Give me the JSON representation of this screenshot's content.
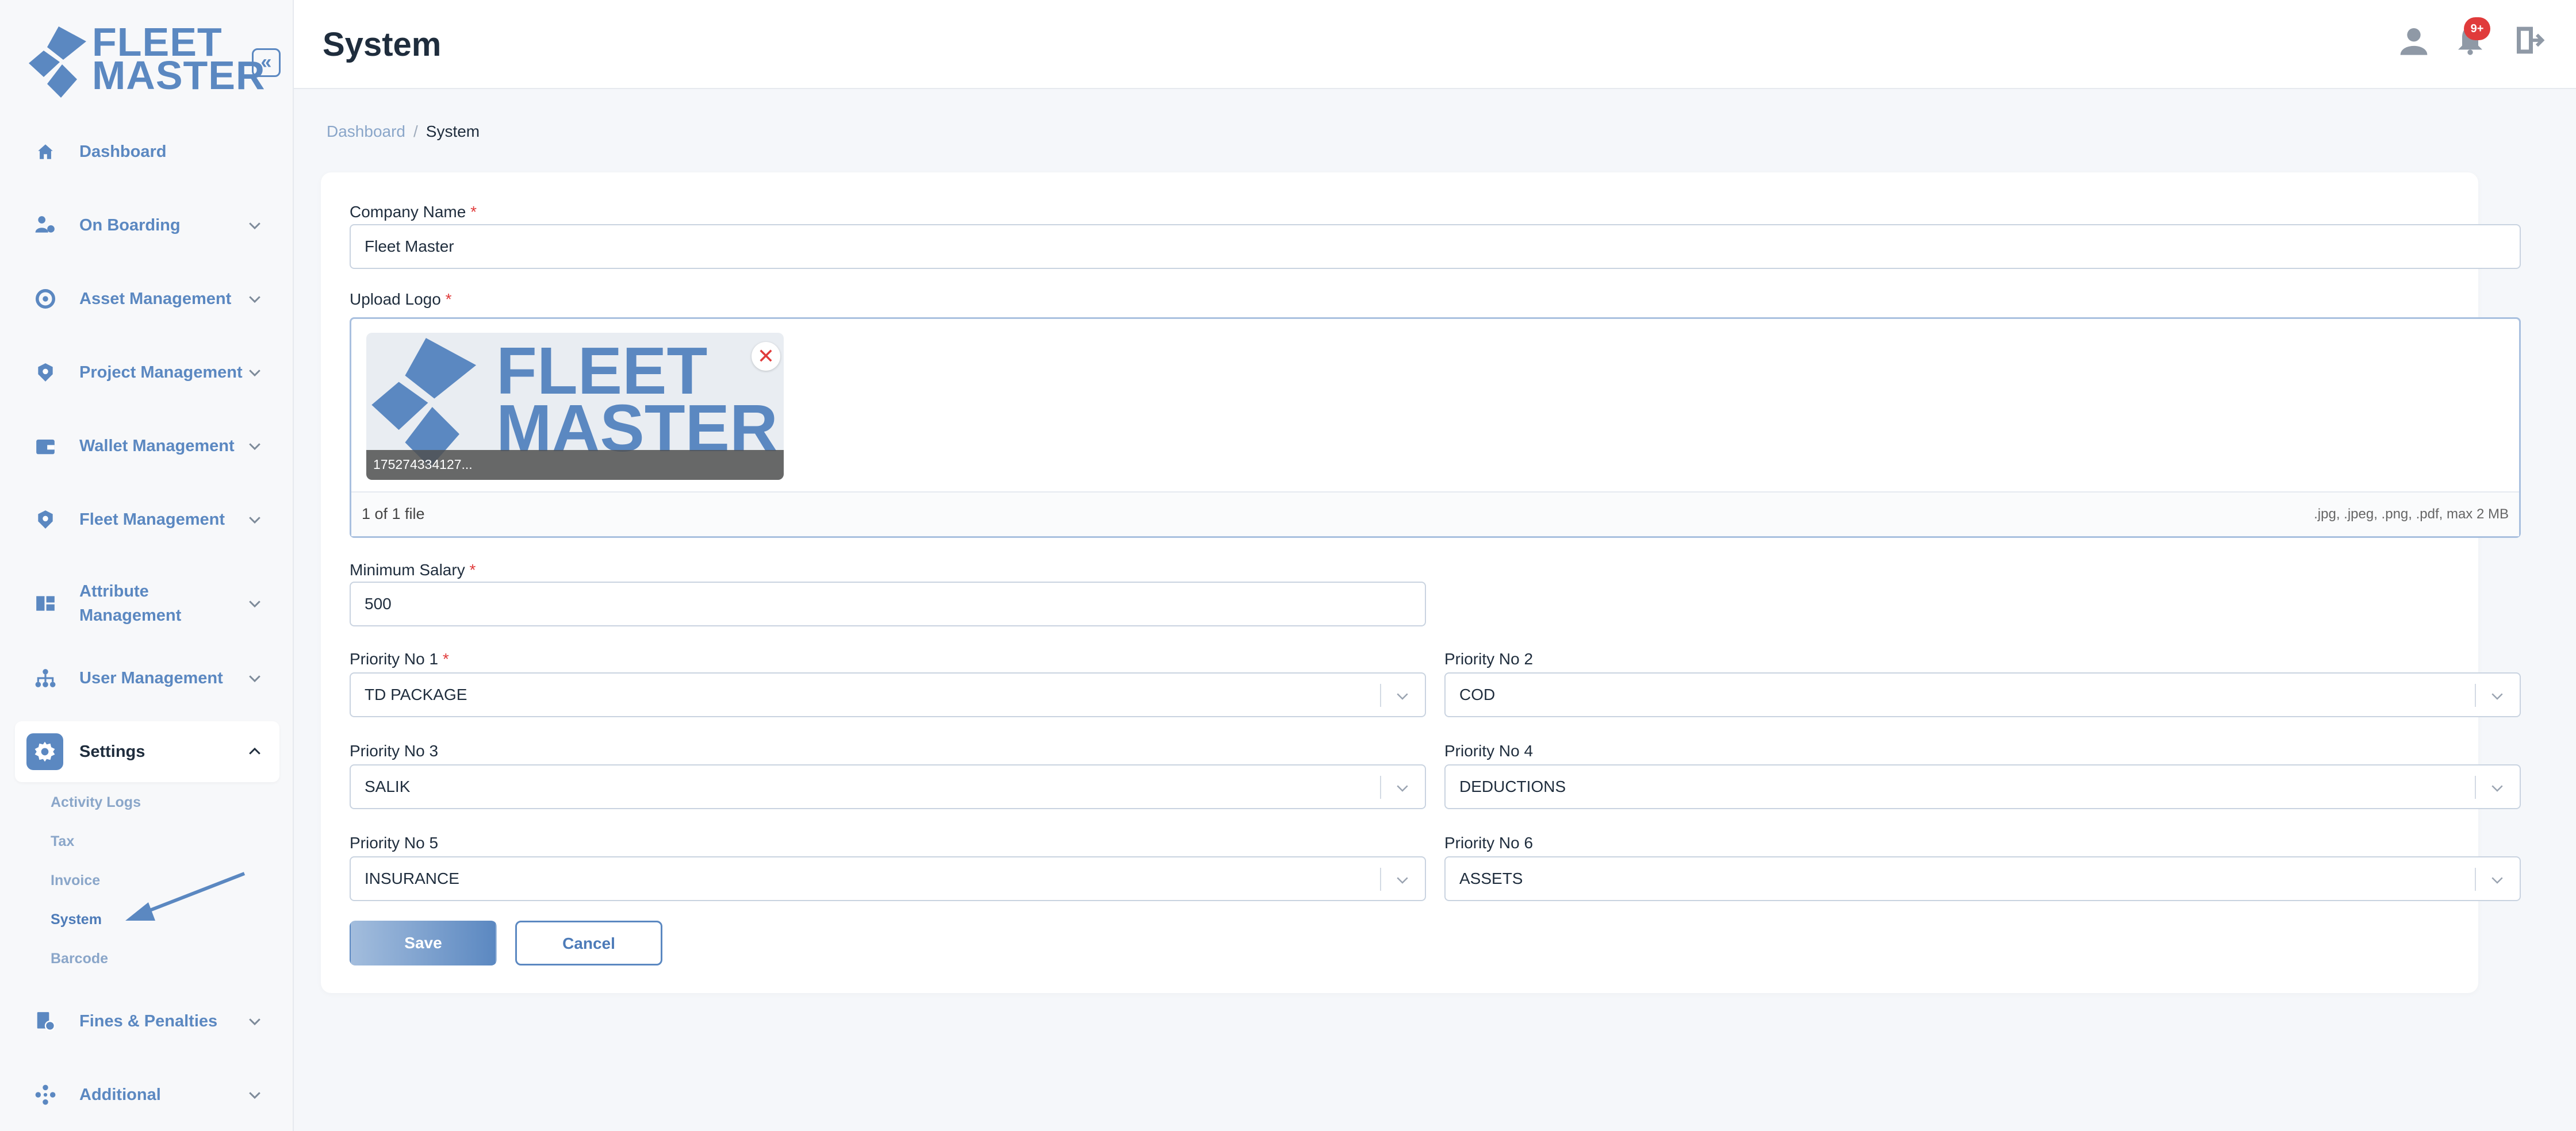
{
  "brand": {
    "line1": "FLEET",
    "line2": "MASTER"
  },
  "sidebar": {
    "collapse_glyph": "«",
    "items": [
      {
        "label": "Dashboard",
        "icon": "home-icon"
      },
      {
        "label": "On Boarding",
        "icon": "user-onboard-icon"
      },
      {
        "label": "Asset Management",
        "icon": "asset-icon"
      },
      {
        "label": "Project Management",
        "icon": "project-icon"
      },
      {
        "label": "Wallet Management",
        "icon": "wallet-icon"
      },
      {
        "label": "Fleet Management",
        "icon": "fleet-icon"
      },
      {
        "label": "Attribute Management",
        "label_line1": "Attribute",
        "label_line2": "Management",
        "icon": "attribute-icon"
      },
      {
        "label": "User Management",
        "icon": "users-hierarchy-icon"
      },
      {
        "label": "Settings",
        "icon": "gear-icon",
        "active": true
      },
      {
        "label": "Fines & Penalties",
        "icon": "fines-icon"
      },
      {
        "label": "Additional",
        "icon": "additional-icon"
      }
    ],
    "settings_sub": [
      {
        "label": "Activity Logs"
      },
      {
        "label": "Tax"
      },
      {
        "label": "Invoice"
      },
      {
        "label": "System",
        "active": true
      },
      {
        "label": "Barcode"
      }
    ]
  },
  "header": {
    "title": "System",
    "notification_badge": "9+"
  },
  "breadcrumb": {
    "home": "Dashboard",
    "separator": "/",
    "current": "System"
  },
  "form": {
    "company_name": {
      "label": "Company Name",
      "required_mark": "*",
      "value": "Fleet Master"
    },
    "upload_logo": {
      "label": "Upload Logo",
      "required_mark": "*",
      "thumb_text_line1": "FLEET",
      "thumb_text_line2": "MASTER",
      "file_name": "175274334127...",
      "remove_glyph": "✕",
      "count": "1 of 1 file",
      "hint": ".jpg, .jpeg, .png, .pdf, max 2 MB"
    },
    "minimum_salary": {
      "label": "Minimum Salary",
      "required_mark": "*",
      "value": "500"
    },
    "priorities": [
      {
        "label": "Priority No 1",
        "required_mark": "*",
        "value": "TD PACKAGE"
      },
      {
        "label": "Priority No 2",
        "required_mark": "",
        "value": "COD"
      },
      {
        "label": "Priority No 3",
        "required_mark": "",
        "value": "SALIK"
      },
      {
        "label": "Priority No 4",
        "required_mark": "",
        "value": "DEDUCTIONS"
      },
      {
        "label": "Priority No 5",
        "required_mark": "",
        "value": "INSURANCE"
      },
      {
        "label": "Priority No 6",
        "required_mark": "",
        "value": "ASSETS"
      }
    ],
    "save_label": "Save",
    "cancel_label": "Cancel"
  },
  "colors": {
    "accent": "#5b88c1",
    "required": "#e03b3b",
    "badge": "#e03b3b"
  }
}
